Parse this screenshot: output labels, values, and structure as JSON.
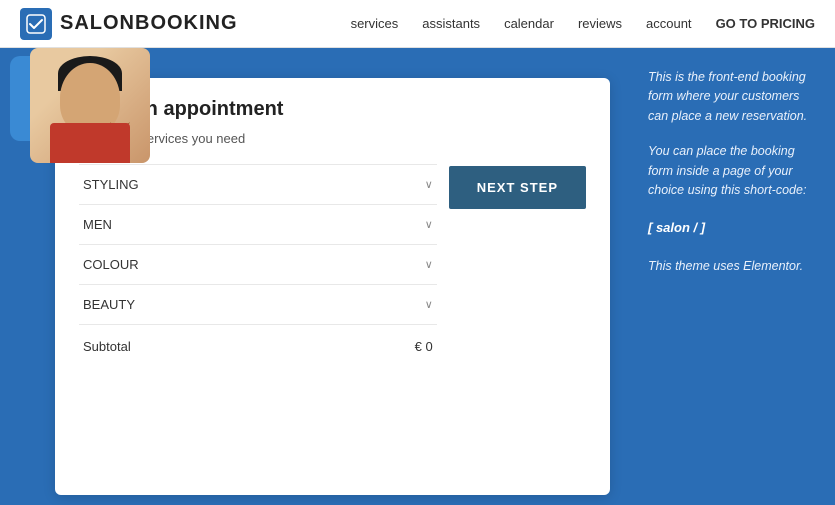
{
  "header": {
    "logo_text": "SALONBOOKING",
    "nav_items": [
      {
        "label": "services",
        "id": "services"
      },
      {
        "label": "assistants",
        "id": "assistants"
      },
      {
        "label": "calendar",
        "id": "calendar"
      },
      {
        "label": "reviews",
        "id": "reviews"
      },
      {
        "label": "account",
        "id": "account"
      },
      {
        "label": "GO TO PRICING",
        "id": "pricing"
      }
    ]
  },
  "booking": {
    "title": "Book an appointment",
    "subtitle": "Select the services you need",
    "services": [
      {
        "label": "STYLING"
      },
      {
        "label": "MEN"
      },
      {
        "label": "COLOUR"
      },
      {
        "label": "BEAUTY"
      }
    ],
    "next_step_label": "NEXT STEP",
    "subtotal_label": "Subtotal",
    "subtotal_value": "€ 0"
  },
  "sidebar": {
    "info_text_1": "This is the front-end booking form where your customers can place a new reservation.",
    "info_text_2": "You can place the booking form inside a page of your choice using this short-code:",
    "shortcode": "[ salon / ]",
    "elementor_text": "This theme uses Elementor."
  },
  "icons": {
    "chevron": "∨",
    "logo_check": "✓"
  }
}
